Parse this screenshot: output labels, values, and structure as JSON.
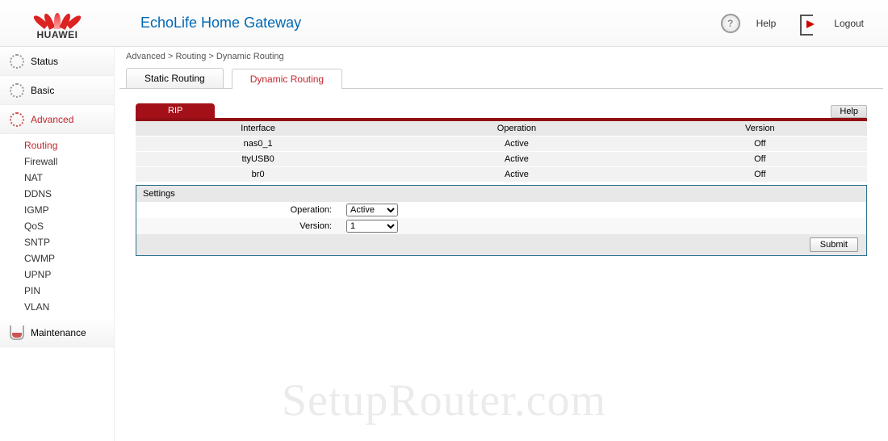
{
  "brand": "HUAWEI",
  "app_title": "EchoLife Home Gateway",
  "header": {
    "help": "Help",
    "logout": "Logout"
  },
  "breadcrumb": "Advanced > Routing > Dynamic Routing",
  "tabs": {
    "static": "Static Routing",
    "dynamic": "Dynamic Routing"
  },
  "sidebar": {
    "status": "Status",
    "basic": "Basic",
    "advanced": "Advanced",
    "maintenance": "Maintenance",
    "sub": [
      "Routing",
      "Firewall",
      "NAT",
      "DDNS",
      "IGMP",
      "QoS",
      "SNTP",
      "CWMP",
      "UPNP",
      "PIN",
      "VLAN"
    ]
  },
  "panel": {
    "title": "RIP",
    "help_btn": "Help",
    "cols": {
      "interface": "Interface",
      "operation": "Operation",
      "version": "Version"
    },
    "rows": [
      {
        "if": "nas0_1",
        "op": "Active",
        "ver": "Off"
      },
      {
        "if": "ttyUSB0",
        "op": "Active",
        "ver": "Off"
      },
      {
        "if": "br0",
        "op": "Active",
        "ver": "Off"
      }
    ]
  },
  "settings": {
    "title": "Settings",
    "operation_label": "Operation:",
    "operation_value": "Active",
    "version_label": "Version:",
    "version_value": "1",
    "submit": "Submit"
  },
  "watermark": "SetupRouter.com"
}
